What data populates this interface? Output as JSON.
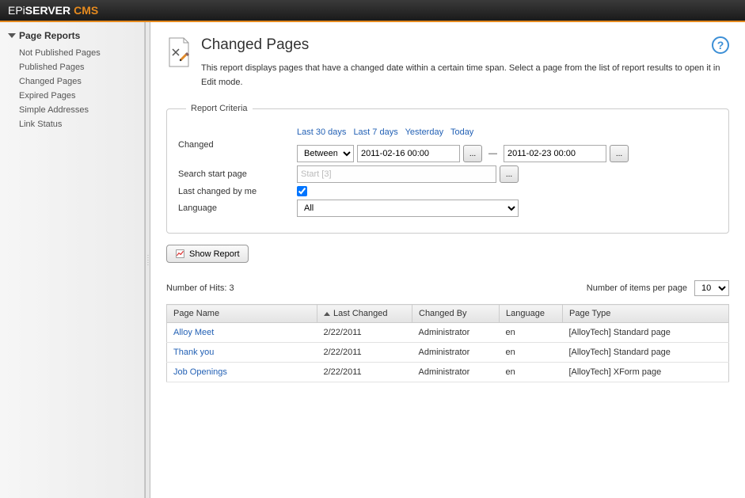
{
  "brand": {
    "epi": "EPi",
    "server": "SERVER",
    "cms": "CMS"
  },
  "sidebar": {
    "title": "Page Reports",
    "items": [
      {
        "label": "Not Published Pages"
      },
      {
        "label": "Published Pages"
      },
      {
        "label": "Changed Pages"
      },
      {
        "label": "Expired Pages"
      },
      {
        "label": "Simple Addresses"
      },
      {
        "label": "Link Status"
      }
    ]
  },
  "header": {
    "title": "Changed Pages",
    "description": "This report displays pages that have a changed date within a certain time span. Select a page from the list of report results to open it in Edit mode."
  },
  "criteria": {
    "legend": "Report Criteria",
    "labels": {
      "changed": "Changed",
      "search_start": "Search start page",
      "lcm": "Last changed by me",
      "language": "Language"
    },
    "quick": {
      "d30": "Last 30 days",
      "d7": "Last 7 days",
      "yesterday": "Yesterday",
      "today": "Today"
    },
    "between_select": "Between",
    "date_from": "2011-02-16 00:00",
    "date_to": "2011-02-23 00:00",
    "start_page": "Start [3]",
    "lcm_checked": true,
    "language_value": "All",
    "picker_label": "..."
  },
  "show_report_label": "Show Report",
  "results": {
    "hits_label": "Number of Hits:",
    "hits": "3",
    "per_page_label": "Number of items per page",
    "per_page_value": "10",
    "columns": {
      "page_name": "Page Name",
      "last_changed": "Last Changed",
      "changed_by": "Changed By",
      "language": "Language",
      "page_type": "Page Type"
    },
    "rows": [
      {
        "name": "Alloy Meet",
        "last": "2/22/2011",
        "by": "Administrator",
        "lang": "en",
        "type": "[AlloyTech] Standard page"
      },
      {
        "name": "Thank you",
        "last": "2/22/2011",
        "by": "Administrator",
        "lang": "en",
        "type": "[AlloyTech] Standard page"
      },
      {
        "name": "Job Openings",
        "last": "2/22/2011",
        "by": "Administrator",
        "lang": "en",
        "type": "[AlloyTech] XForm page"
      }
    ]
  }
}
